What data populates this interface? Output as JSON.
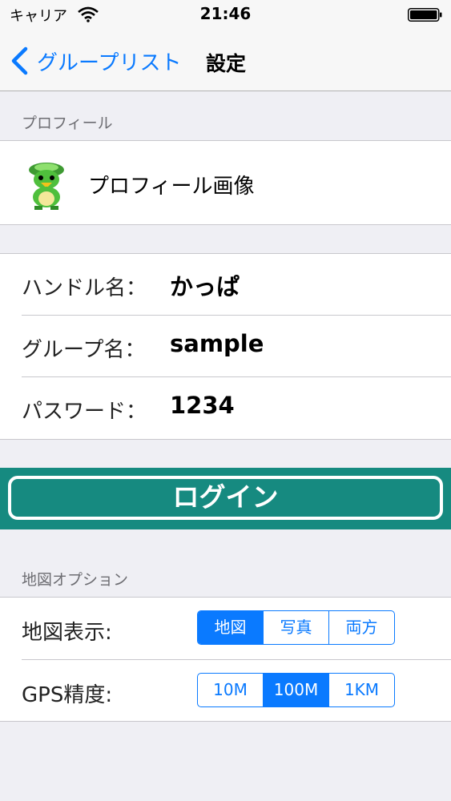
{
  "status_bar": {
    "carrier": "キャリア",
    "time": "21:46"
  },
  "nav": {
    "back_label": "グループリスト",
    "title": "設定"
  },
  "profile_section": {
    "header": "プロフィール",
    "profile_image_label": "プロフィール画像"
  },
  "account": {
    "rows": [
      {
        "label": "ハンドル名：",
        "value": "かっぱ"
      },
      {
        "label": "グループ名：",
        "value": "sample"
      },
      {
        "label": "パスワード：",
        "value": "1234"
      }
    ]
  },
  "login": {
    "label": "ログイン",
    "bar_color": "#168a80"
  },
  "map_section": {
    "header": "地図オプション",
    "map_display": {
      "label": "地図表示:",
      "options": [
        "地図",
        "写真",
        "両方"
      ],
      "selected": "地図"
    },
    "gps_accuracy": {
      "label": "GPS精度:",
      "options": [
        "10M",
        "100M",
        "1KM"
      ],
      "selected": "100M"
    }
  },
  "colors": {
    "accent": "#0a7aff",
    "login_teal": "#168a80",
    "background": "#efeff4"
  },
  "icons": [
    "wifi-icon",
    "battery-icon",
    "back-chevron-icon",
    "kappa-avatar"
  ]
}
